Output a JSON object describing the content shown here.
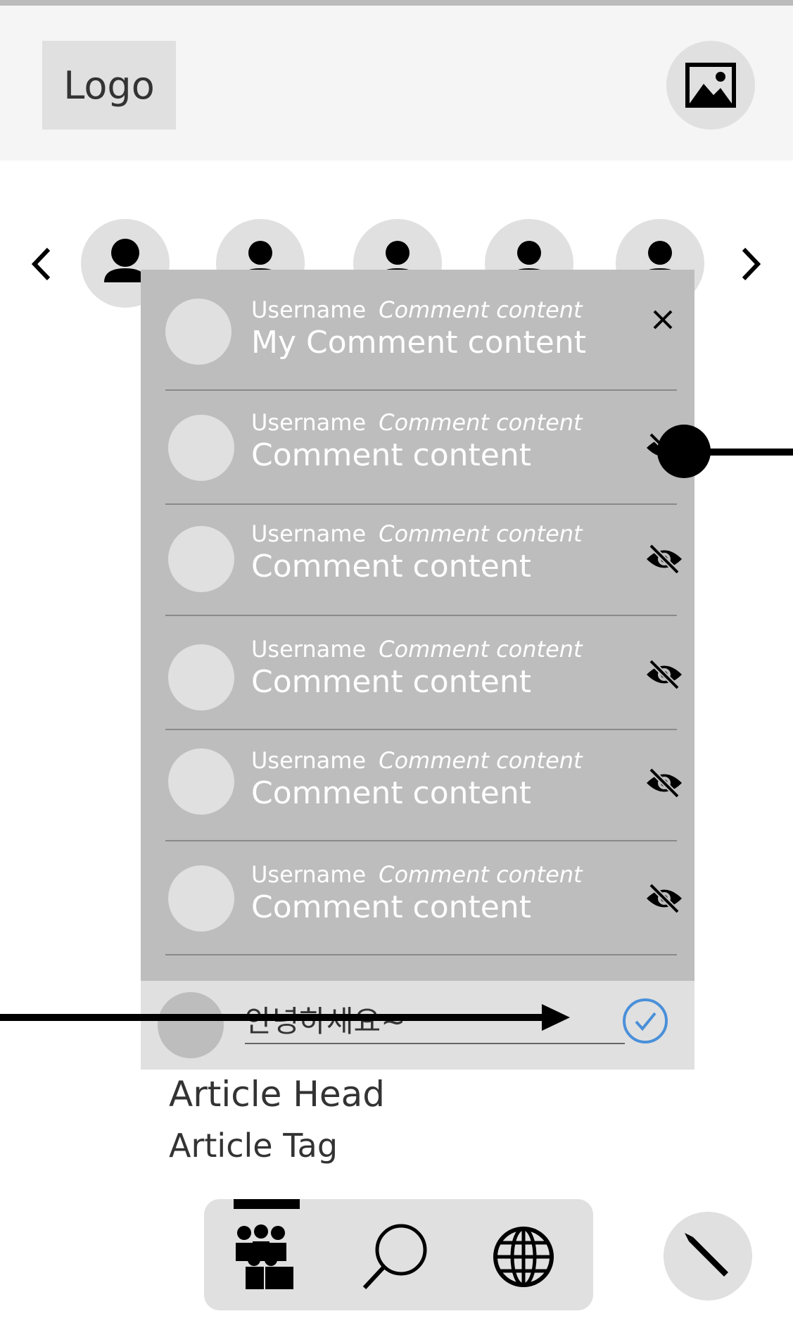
{
  "header": {
    "logo_text": "Logo",
    "image_icon": "image-icon"
  },
  "stories": {
    "prev_icon": "chevron-left-icon",
    "next_icon": "chevron-right-icon",
    "count": 5
  },
  "comments_panel": {
    "close_icon": "close-icon",
    "my_comment": {
      "username": "Username",
      "meta": "Comment content",
      "text": "My Comment content"
    },
    "comments": [
      {
        "username": "Username",
        "meta": "Comment content",
        "text": "Comment content",
        "icon": "eye-off-icon"
      },
      {
        "username": "Username",
        "meta": "Comment content",
        "text": "Comment content",
        "icon": "eye-off-icon"
      },
      {
        "username": "Username",
        "meta": "Comment content",
        "text": " Comment content",
        "icon": "eye-off-icon"
      },
      {
        "username": "Username",
        "meta": "Comment content",
        "text": "Comment content",
        "icon": "eye-off-icon"
      },
      {
        "username": "Username",
        "meta": "Comment content",
        "text": "Comment content",
        "icon": "eye-off-icon"
      }
    ]
  },
  "comment_input": {
    "value": "안녕하세요~",
    "submit_icon": "check-circle-icon"
  },
  "article": {
    "head": "Article Head",
    "tag": "Article Tag"
  },
  "bottom_nav": {
    "items": [
      "people-icon",
      "search-icon",
      "globe-icon"
    ]
  },
  "fab": {
    "icon": "pencil-icon"
  },
  "colors": {
    "panel_bg": "#bdbdbd",
    "light_bg": "#e0e0e0",
    "check_blue": "#4a90d9"
  }
}
